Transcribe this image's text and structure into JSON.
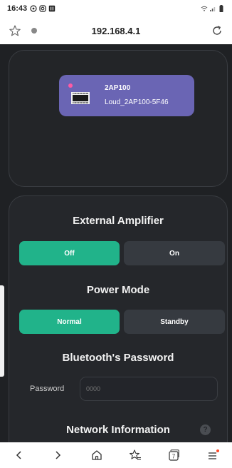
{
  "status": {
    "time": "16:43",
    "icons": [
      "whatsapp-icon",
      "instagram-icon",
      "notification-app-icon"
    ],
    "right_icons": [
      "wifi-icon",
      "signal-icon",
      "battery-icon"
    ]
  },
  "browser": {
    "url": "192.168.4.1",
    "tab_count": "7"
  },
  "device": {
    "name": "2AP100",
    "subname": "Loud_2AP100-5F46"
  },
  "external_amplifier": {
    "title": "External Amplifier",
    "options": [
      "Off",
      "On"
    ],
    "selected": "Off"
  },
  "power_mode": {
    "title": "Power Mode",
    "options": [
      "Normal",
      "Standby"
    ],
    "selected": "Normal"
  },
  "bluetooth": {
    "title": "Bluetooth's Password",
    "password_label": "Password",
    "password_placeholder": "0000"
  },
  "network": {
    "title": "Network Information",
    "help_glyph": "?"
  },
  "colors": {
    "accent": "#21b38a",
    "device_card": "#6a65b4",
    "page_bg": "#1f2124",
    "status_dot": "#ff5aa5"
  }
}
